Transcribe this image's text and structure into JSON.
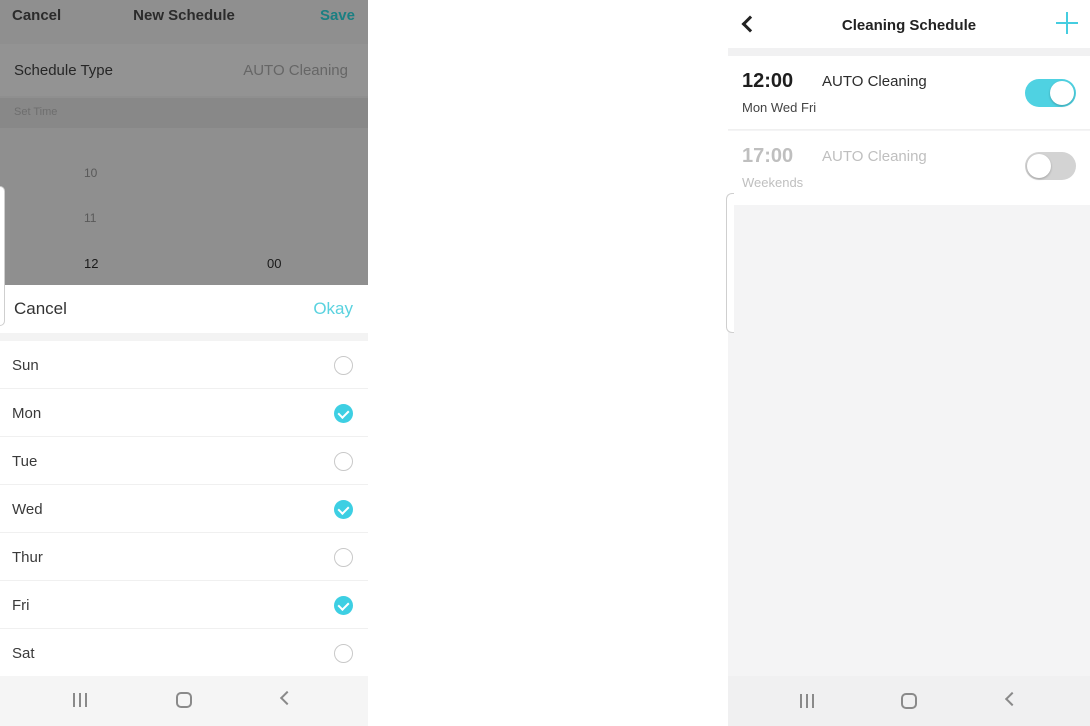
{
  "left_screen": {
    "header": {
      "cancel_label": "Cancel",
      "title": "New Schedule",
      "save_label": "Save"
    },
    "schedule_type": {
      "label": "Schedule Type",
      "value": "AUTO Cleaning"
    },
    "set_time": {
      "label": "Set Time",
      "hours": [
        "10",
        "11",
        "12"
      ],
      "minute": "00",
      "selected_hour": "12"
    },
    "repeat_sheet": {
      "cancel_label": "Cancel",
      "okay_label": "Okay",
      "days": [
        {
          "label": "Sun",
          "checked": false
        },
        {
          "label": "Mon",
          "checked": true
        },
        {
          "label": "Tue",
          "checked": false
        },
        {
          "label": "Wed",
          "checked": true
        },
        {
          "label": "Thur",
          "checked": false
        },
        {
          "label": "Fri",
          "checked": true
        },
        {
          "label": "Sat",
          "checked": false
        }
      ]
    },
    "nav": {
      "recent_icon": "recent-apps-icon",
      "home_icon": "home-icon",
      "back_icon": "back-icon"
    },
    "colors": {
      "accent": "#3dcfe3",
      "overlay": "#8f8f8f"
    }
  },
  "right_screen": {
    "header": {
      "title": "Cleaning Schedule",
      "back_icon": "chevron-left-icon",
      "add_icon": "plus-icon"
    },
    "schedules": [
      {
        "time": "12:00",
        "mode": "AUTO Cleaning",
        "days": "Mon Wed Fri",
        "enabled": true
      },
      {
        "time": "17:00",
        "mode": "AUTO Cleaning",
        "days": "Weekends",
        "enabled": false
      }
    ],
    "nav": {
      "recent_icon": "recent-apps-icon",
      "home_icon": "home-icon",
      "back_icon": "back-icon"
    },
    "colors": {
      "accent": "#4fd2e2",
      "toggle_off": "#d3d3d3"
    }
  }
}
